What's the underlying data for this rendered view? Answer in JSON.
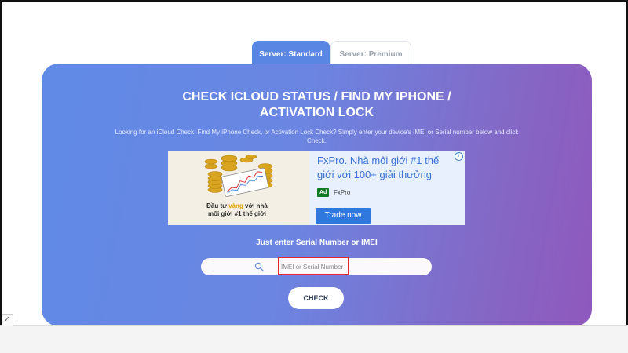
{
  "tabs": [
    {
      "label": "Server: Standard",
      "active": true
    },
    {
      "label": "Server: Premium",
      "active": false
    }
  ],
  "main": {
    "title_line1": "CHECK ICLOUD STATUS / FIND MY IPHONE /",
    "title_line2": "ACTIVATION LOCK",
    "description": "Looking for an iCloud Check, Find My iPhone Check, or Activation Lock Check? Simply enter your device's IMEI or Serial number below and click Check.",
    "prompt": "Just enter Serial Number or IMEI",
    "search_placeholder": "IMEI or Serial Number",
    "search_value": "",
    "check_label": "CHECK"
  },
  "ad": {
    "headline": "FxPro. Nhà môi giới #1 thế giới với 100+ giải thưởng",
    "badge": "Ad",
    "brand": "FxPro",
    "cta": "Trade now",
    "choices_icon": "adchoices-icon",
    "image_caption_part1": "Đầu tư ",
    "image_caption_highlight": "vàng",
    "image_caption_part2": " với nhà môi giới #1 thế giới"
  },
  "colors": {
    "tab_active": "#5a86e3",
    "card_gradient_start": "#5f8ae6",
    "card_gradient_end": "#8f58bd",
    "highlight_box": "#e2262b",
    "ad_button": "#2f78dd"
  }
}
